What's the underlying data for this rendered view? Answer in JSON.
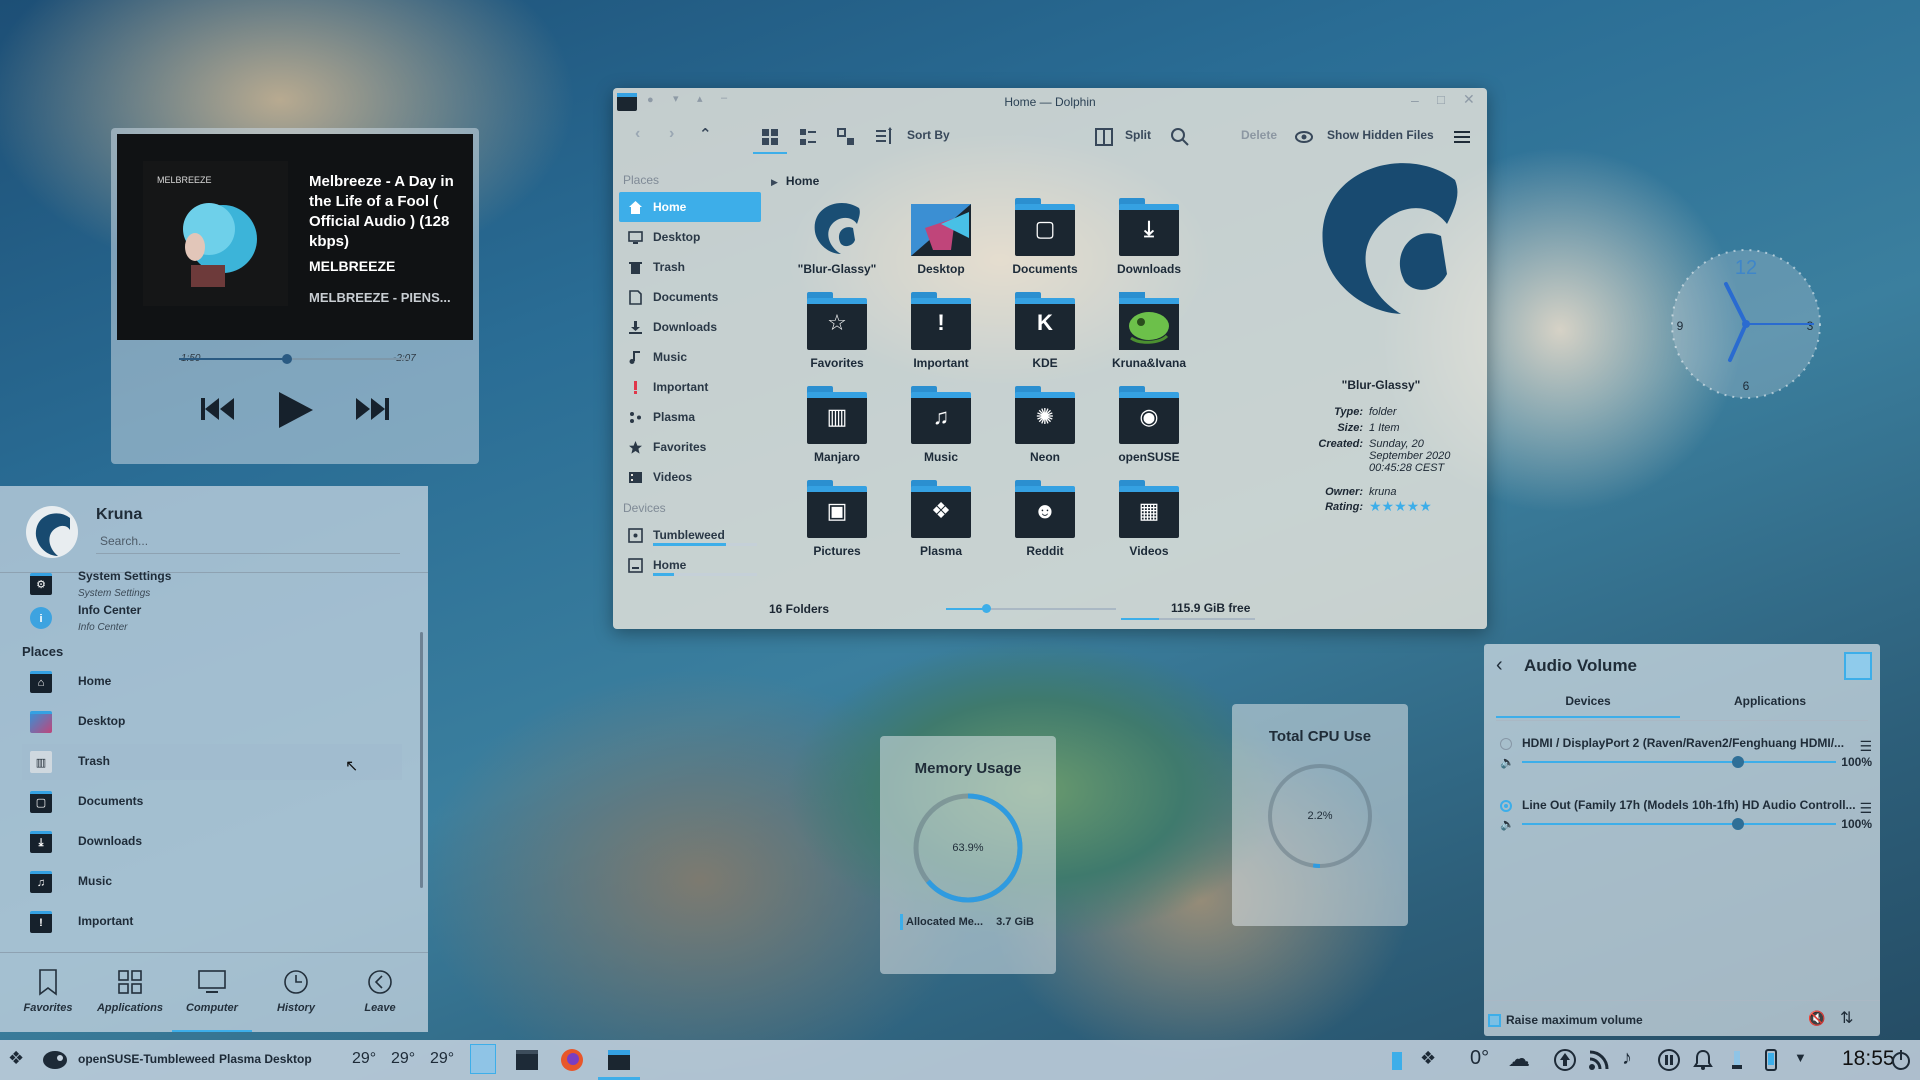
{
  "media_player": {
    "title": "Melbreeze - A Day in the Life of a Fool ( Official Audio ) (128 kbps)",
    "artist": "MELBREEZE",
    "album": "MELBREEZE - PIENS...",
    "cover_label": "MELBREEZE",
    "elapsed": "1:50",
    "remaining": "-2:07",
    "progress": 0.47
  },
  "dolphin": {
    "title": "Home — Dolphin",
    "toolbar": {
      "sort_by": "Sort By",
      "split": "Split",
      "delete": "Delete",
      "show_hidden": "Show Hidden Files"
    },
    "places_header": "Places",
    "places": [
      {
        "label": "Home",
        "icon": "home-icon"
      },
      {
        "label": "Desktop",
        "icon": "desktop-icon"
      },
      {
        "label": "Trash",
        "icon": "trash-icon"
      },
      {
        "label": "Documents",
        "icon": "documents-icon"
      },
      {
        "label": "Downloads",
        "icon": "downloads-icon"
      },
      {
        "label": "Music",
        "icon": "music-icon"
      },
      {
        "label": "Important",
        "icon": "important-icon"
      },
      {
        "label": "Plasma",
        "icon": "plasma-icon"
      },
      {
        "label": "Favorites",
        "icon": "star-icon"
      },
      {
        "label": "Videos",
        "icon": "videos-icon"
      }
    ],
    "devices_header": "Devices",
    "devices": [
      {
        "label": "Tumbleweed",
        "usage": 0.7
      },
      {
        "label": "Home",
        "usage": 0.2
      }
    ],
    "breadcrumb": "Home",
    "files": [
      {
        "label": "\"Blur-Glassy\"",
        "glyph": ""
      },
      {
        "label": "Desktop",
        "glyph": ""
      },
      {
        "label": "Documents",
        "glyph": "▢"
      },
      {
        "label": "Downloads",
        "glyph": "⤓"
      },
      {
        "label": "Favorites",
        "glyph": "☆"
      },
      {
        "label": "Important",
        "glyph": "!"
      },
      {
        "label": "KDE",
        "glyph": "K"
      },
      {
        "label": "Kruna&Ivana",
        "glyph": ""
      },
      {
        "label": "Manjaro",
        "glyph": "▥"
      },
      {
        "label": "Music",
        "glyph": "♫"
      },
      {
        "label": "Neon",
        "glyph": "✺"
      },
      {
        "label": "openSUSE",
        "glyph": "◉"
      },
      {
        "label": "Pictures",
        "glyph": "▣"
      },
      {
        "label": "Plasma",
        "glyph": "❖"
      },
      {
        "label": "Reddit",
        "glyph": "☻"
      },
      {
        "label": "Videos",
        "glyph": "▦"
      }
    ],
    "info": {
      "name": "\"Blur-Glassy\"",
      "rows": [
        {
          "k": "Type:",
          "v": "folder"
        },
        {
          "k": "Size:",
          "v": "1 Item"
        },
        {
          "k": "Created:",
          "v": "Sunday, 20 September 2020 00:45:28 CEST"
        },
        {
          "k": "Owner:",
          "v": "kruna"
        },
        {
          "k": "Rating:",
          "v": "★★★★★"
        }
      ]
    },
    "status": {
      "folders": "16 Folders",
      "free": "115.9 GiB free"
    }
  },
  "launcher": {
    "user": "Kruna",
    "search_placeholder": "Search...",
    "apps": [
      {
        "title": "System Settings",
        "subtitle": "System Settings"
      },
      {
        "title": "Info Center",
        "subtitle": "Info Center"
      }
    ],
    "places_header": "Places",
    "places": [
      "Home",
      "Desktop",
      "Trash",
      "Documents",
      "Downloads",
      "Music",
      "Important"
    ],
    "tabs": [
      "Favorites",
      "Applications",
      "Computer",
      "History",
      "Leave"
    ],
    "active_tab": "Computer"
  },
  "clock_widget": {
    "hour": 12,
    "label_12": "12",
    "label_3": "3",
    "label_6": "6",
    "label_9": "9"
  },
  "memory": {
    "title": "Memory Usage",
    "value": "63.9%",
    "percent": 63.9,
    "foot_label": "Allocated Me...",
    "foot_value": "3.7 GiB"
  },
  "cpu": {
    "title": "Total CPU Use",
    "value": "2.2%",
    "percent": 2.2
  },
  "audio": {
    "title": "Audio Volume",
    "tabs": [
      "Devices",
      "Applications"
    ],
    "devices": [
      {
        "name": "HDMI / DisplayPort 2 (Raven/Raven2/Fenghuang HDMI/...",
        "volume": "100%",
        "selected": false
      },
      {
        "name": "Line Out (Family 17h (Models 10h-1fh) HD Audio Controll...",
        "volume": "100%",
        "selected": true
      }
    ],
    "raise_label": "Raise maximum volume"
  },
  "taskbar": {
    "distro": "openSUSE-Tumbleweed",
    "desktop": "Plasma Desktop",
    "temps": [
      "29°",
      "29°",
      "29°"
    ],
    "weather": "0°",
    "clock": "18:55"
  },
  "colors": {
    "accent": "#3daee9",
    "folder_dark": "#1b2630"
  }
}
